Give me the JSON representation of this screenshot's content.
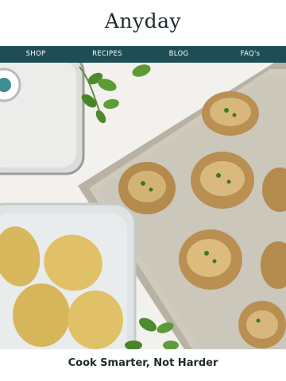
{
  "brand": {
    "logo_text": "Anyday"
  },
  "nav": {
    "items": [
      "SHOP",
      "RECIPES",
      "BLOG",
      "FAQ's"
    ]
  },
  "hero": {
    "image_name": "smashed-potatoes-photo"
  },
  "content": {
    "heading": "Cook Smarter, Not Harder",
    "subtext": ""
  },
  "colors": {
    "nav_bg": "#1f4d55",
    "text_dark": "#1e2b2f",
    "background": "#ffffff"
  }
}
